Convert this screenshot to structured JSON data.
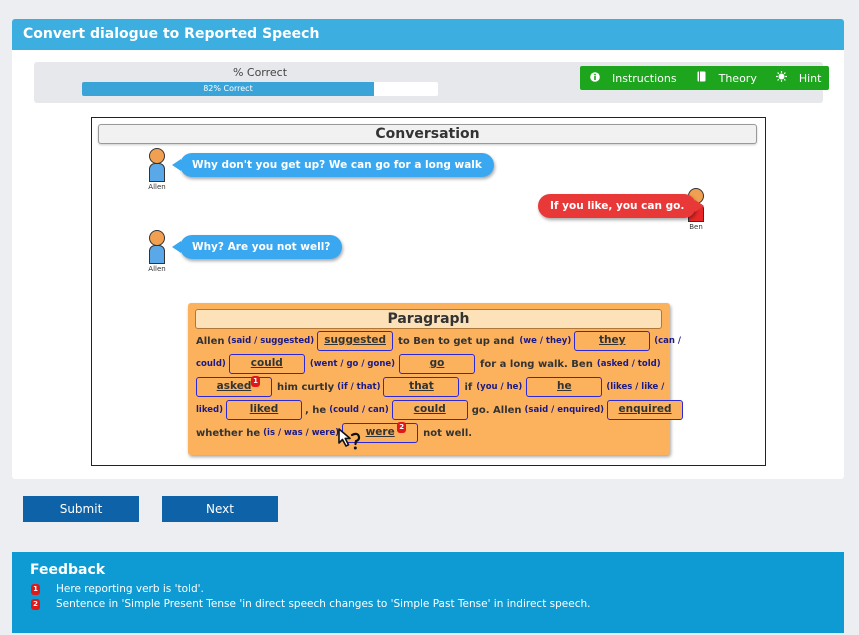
{
  "header": {
    "title": "Convert dialogue to Reported Speech"
  },
  "progress": {
    "label": "% Correct",
    "value_text": "82% Correct",
    "percent": 82
  },
  "tools": [
    {
      "icon": "info-icon",
      "label": "Instructions"
    },
    {
      "icon": "book-icon",
      "label": "Theory"
    },
    {
      "icon": "lightbulb-icon",
      "label": "Hint"
    }
  ],
  "conversation": {
    "title": "Conversation",
    "messages": [
      {
        "speaker": "Allen",
        "text": "Why don't you get up? We can go for a long walk"
      },
      {
        "speaker": "Ben",
        "text": "If you like, you can go."
      },
      {
        "speaker": "Allen",
        "text": "Why? Are you not well?"
      }
    ]
  },
  "paragraph": {
    "title": "Paragraph",
    "line1": {
      "t1": "Allen",
      "o1": "(said / suggested)",
      "b1": "suggested",
      "t2": "to Ben to get up and",
      "o2": "(we / they)",
      "b2": "they",
      "o3": "(can /"
    },
    "line2": {
      "o1": "could)",
      "b1": "could",
      "o2": "(went / go / gone)",
      "b2": "go",
      "t1": "for a long walk. Ben",
      "o3": "(asked / told)"
    },
    "line3": {
      "b1": "asked",
      "m1": "1",
      "t1": "him curtly",
      "o1": "(if / that)",
      "b2": "that",
      "t2": "if",
      "o2": "(you / he)",
      "b3": "he",
      "o3": "(likes / like /"
    },
    "line4": {
      "o1": "liked)",
      "b1": "liked",
      "t1": ", he",
      "o2": "(could / can)",
      "b2": "could",
      "t2": "go. Allen",
      "o3": "(said / enquired)",
      "b3": "enquired"
    },
    "line5": {
      "t1": "whether he",
      "o1": "(is / was / were)",
      "b1": "were",
      "m1": "2",
      "t2": "not well."
    }
  },
  "buttons": {
    "submit": "Submit",
    "next": "Next"
  },
  "feedback": {
    "title": "Feedback",
    "items": [
      {
        "num": "1",
        "text": "Here reporting verb is 'told'."
      },
      {
        "num": "2",
        "text": "Sentence in 'Simple Present Tense 'in direct speech changes to 'Simple Past Tense' in indirect speech."
      }
    ]
  }
}
